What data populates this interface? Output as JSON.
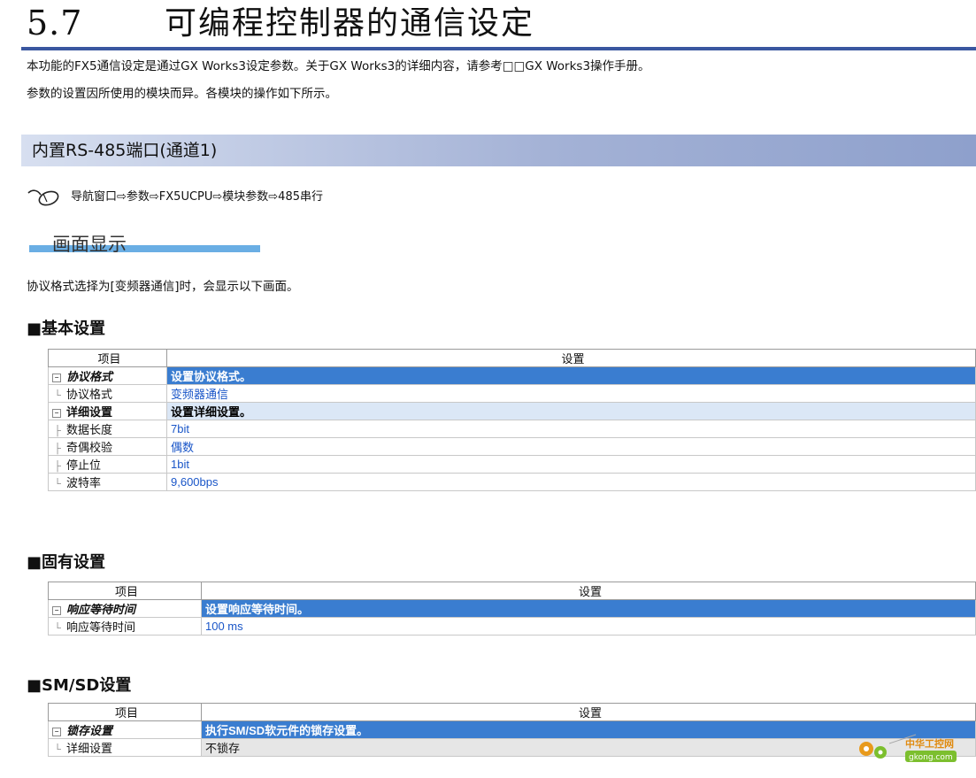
{
  "section": {
    "number": "5.7",
    "title": "可编程控制器的通信设定"
  },
  "intro": {
    "p1": "本功能的FX5通信设定是通过GX Works3设定参数。关于GX Works3的详细内容，请参考□□GX Works3操作手册。",
    "p2": "参数的设置因所使用的模块而异。各模块的操作如下所示。"
  },
  "port_heading": "内置RS-485端口(通道1)",
  "nav": {
    "icon": "mouse-icon",
    "path": "导航窗口⇨参数⇨FX5UCPU⇨模块参数⇨485串行"
  },
  "screen_heading": "画面显示",
  "screen_intro": "协议格式选择为[变频器通信]时，会显示以下画面。",
  "basic": {
    "heading": "■基本设置",
    "col_item": "项目",
    "col_setting": "设置",
    "rows": [
      {
        "key": "协议格式",
        "val": "设置协议格式。"
      },
      {
        "key": "协议格式",
        "val": "变频器通信"
      },
      {
        "key": "详细设置",
        "val": "设置详细设置。"
      },
      {
        "key": "数据长度",
        "val": "7bit"
      },
      {
        "key": "奇偶校验",
        "val": "偶数"
      },
      {
        "key": "停止位",
        "val": "1bit"
      },
      {
        "key": "波特率",
        "val": "9,600bps"
      }
    ]
  },
  "fixed": {
    "heading": "■固有设置",
    "col_item": "项目",
    "col_setting": "设置",
    "rows": [
      {
        "key": "响应等待时间",
        "val": "设置响应等待时间。"
      },
      {
        "key": "响应等待时间",
        "val": "100 ms"
      }
    ]
  },
  "smsd": {
    "heading": "■SM/SD设置",
    "col_item": "项目",
    "col_setting": "设置",
    "rows": [
      {
        "key": "锁存设置",
        "val": "执行SM/SD软元件的锁存设置。"
      },
      {
        "key": "详细设置",
        "val": "不锁存"
      }
    ]
  },
  "watermark": {
    "name": "中华工控网",
    "url": "gkong.com"
  },
  "colors": {
    "title_rule": "#3a57a0",
    "group_blue": "#3a7dd0",
    "value_blue": "#1a56c8",
    "subtitle_bar": "#6aaee4"
  }
}
